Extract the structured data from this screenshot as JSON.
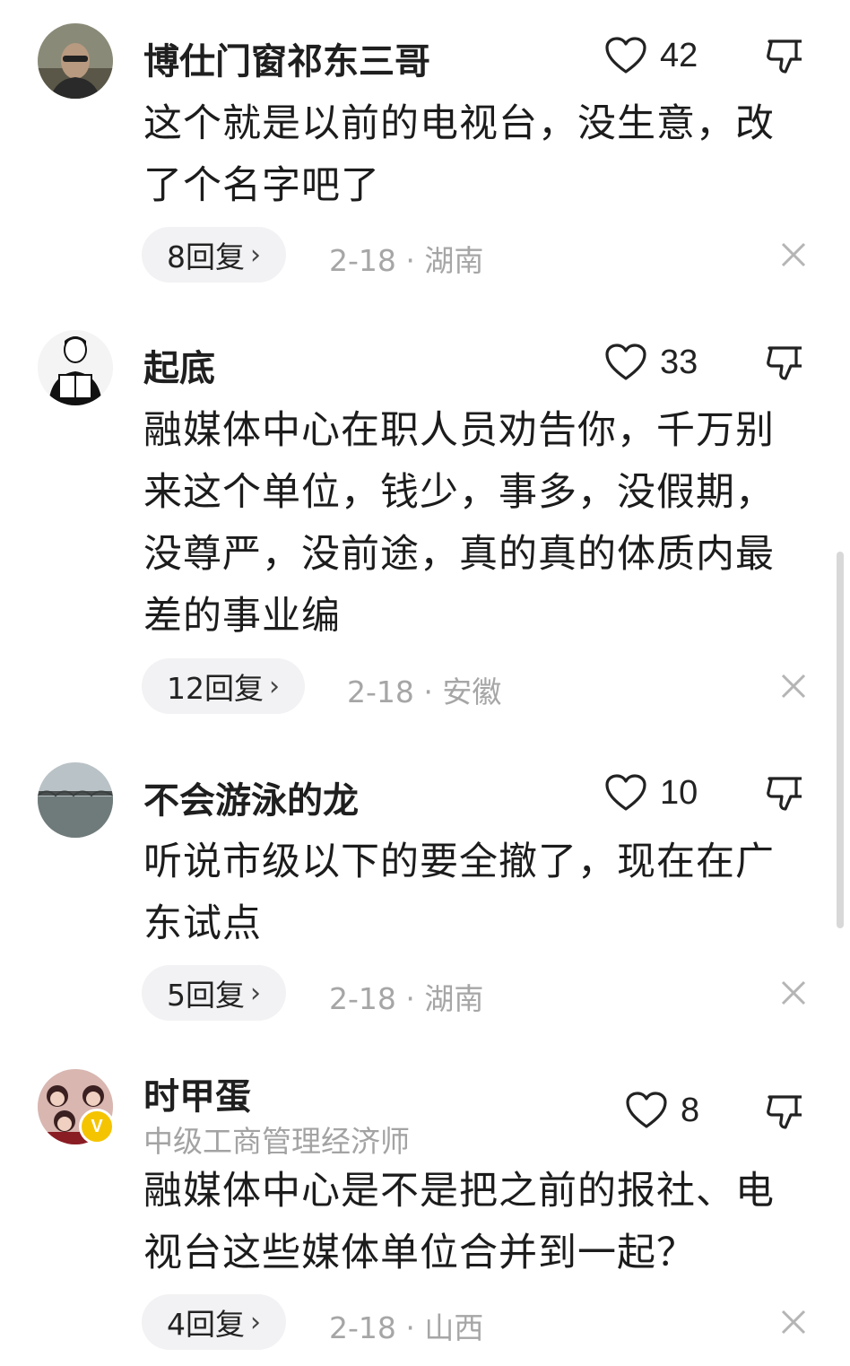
{
  "comments": [
    {
      "username": "博仕门窗祁东三哥",
      "likes": "42",
      "text": "这个就是以前的电视台，没生意，改了个名字吧了",
      "replies": "8回复",
      "meta": "2-18 · 湖南",
      "avatar_icon": "person-photo-avatar"
    },
    {
      "username": "起底",
      "likes": "33",
      "text": "融媒体中心在职人员劝告你，千万别来这个单位，钱少，事多，没假期，没尊严，没前途，真的真的体质内最差的事业编",
      "replies": "12回复",
      "meta": "2-18 · 安徽",
      "avatar_icon": "reading-man-avatar"
    },
    {
      "username": "不会游泳的龙",
      "likes": "10",
      "text": "听说市级以下的要全撤了，现在在广东试点",
      "replies": "5回复",
      "meta": "2-18 · 湖南",
      "avatar_icon": "bridge-landscape-avatar"
    },
    {
      "username": "时甲蛋",
      "user_title": "中级工商管理经济师",
      "verified_badge": "V",
      "likes": "8",
      "text": "融媒体中心是不是把之前的报社、电视台这些媒体单位合并到一起？",
      "replies": "4回复",
      "meta": "2-18 · 山西",
      "avatar_icon": "group-photo-avatar"
    }
  ],
  "icons": {
    "like": "heart-outline-icon",
    "dislike": "thumbs-down-icon",
    "reply_chevron": "›",
    "close": "close-icon"
  },
  "colors": {
    "pill_bg": "#f2f2f4",
    "meta_text": "#a6a6a6",
    "badge": "#f5c400"
  }
}
